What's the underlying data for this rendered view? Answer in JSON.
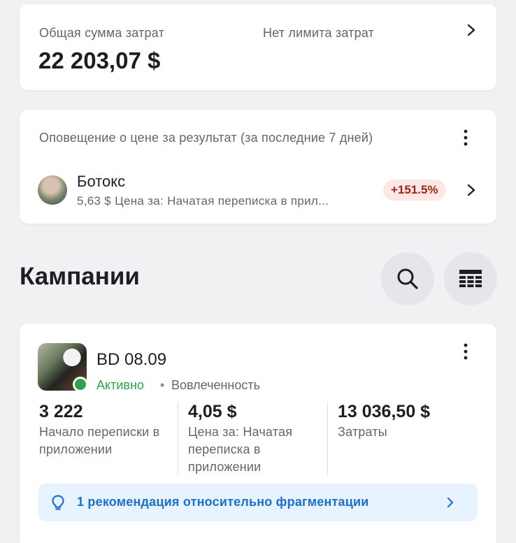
{
  "spend_summary": {
    "total_label": "Общая сумма затрат",
    "total_value": "22 203,07 $",
    "limit_label": "Нет лимита затрат"
  },
  "cost_alert": {
    "title": "Оповещение о цене за результат (за последние 7 дней)",
    "ad": {
      "name": "Ботокс",
      "subtitle": "5,63 $ Цена за: Начатая переписка в прил...",
      "change_badge": "+151.5%"
    }
  },
  "campaigns_section": {
    "title": "Кампании",
    "search_icon": "search-icon",
    "table_icon": "table-view-icon"
  },
  "campaign": {
    "name": "BD 08.09",
    "status": "Активно",
    "separator": "•",
    "objective": "Вовлеченность",
    "metrics": [
      {
        "value": "3 222",
        "label_lines": [
          "Начало переписки в",
          "приложении"
        ]
      },
      {
        "value": "4,05 $",
        "label_lines": [
          "Цена за: Начатая",
          "переписка в",
          "приложении"
        ]
      },
      {
        "value": "13 036,50 $",
        "label_lines": [
          "Затраты"
        ]
      }
    ],
    "recommendation": "1 рекомендация относительно фрагментации"
  },
  "colors": {
    "background": "#f0f1f3",
    "active_green": "#31a24c",
    "badge_red_text": "#a1231a",
    "badge_red_bg": "#fde8e6",
    "link_blue": "#1c6fd1",
    "reco_bg": "#e7f3ff"
  }
}
